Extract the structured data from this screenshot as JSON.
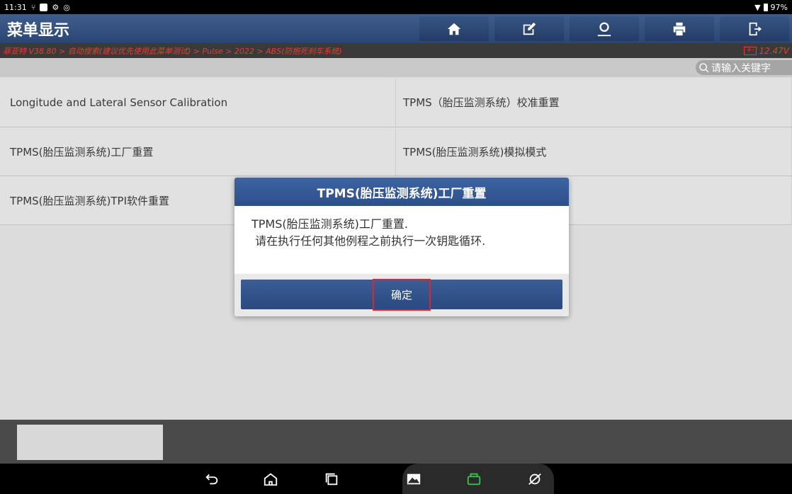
{
  "status_bar": {
    "time": "11:31",
    "battery": "97%"
  },
  "header": {
    "title": "菜单显示",
    "tools": [
      "home-icon",
      "edit-icon",
      "profile-icon",
      "print-icon",
      "exit-icon"
    ]
  },
  "breadcrumb": {
    "path": "菲亚特 V38.80 > 自动搜索(建议优先使用此菜单测试) > Pulse > 2022 > ABS(防抱死刹车系统)",
    "voltage": "12.47V"
  },
  "search": {
    "placeholder": "请输入关键字"
  },
  "menu": {
    "rows": [
      [
        "Longitude and Lateral Sensor Calibration",
        "TPMS（胎压监测系统）校准重置"
      ],
      [
        "TPMS(胎压监测系统)工厂重置",
        "TPMS(胎压监测系统)模拟模式"
      ],
      [
        "TPMS(胎压监测系统)TPI软件重置",
        ""
      ]
    ]
  },
  "dialog": {
    "title": "TPMS(胎压监测系统)工厂重置",
    "line1": "TPMS(胎压监测系统)工厂重置.",
    "line2": " 请在执行任何其他例程之前执行一次钥匙循环.",
    "confirm_label": "确定"
  },
  "colors": {
    "header": "#2b4674",
    "breadcrumb_text": "#e0402a",
    "highlight": "#e0242a"
  }
}
